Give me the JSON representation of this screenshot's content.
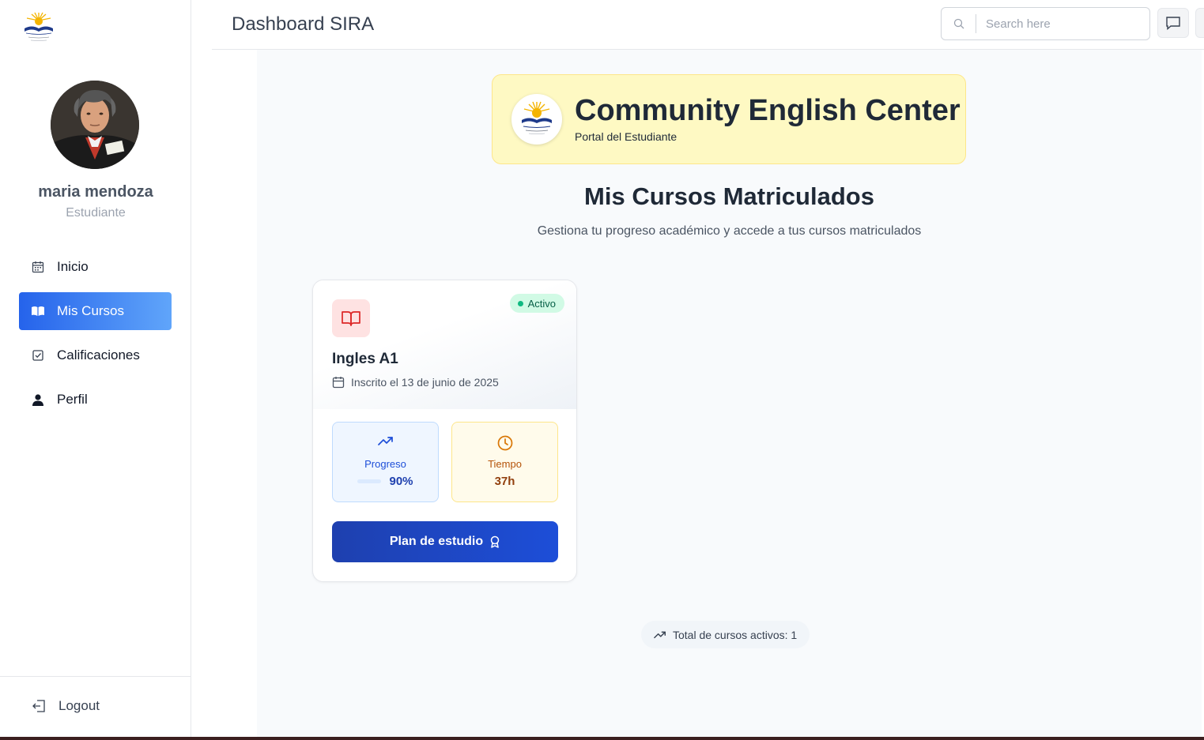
{
  "header": {
    "title": "Dashboard SIRA",
    "search_placeholder": "Search here"
  },
  "sidebar": {
    "user_name": "maria mendoza",
    "user_role": "Estudiante",
    "items": [
      {
        "label": "Inicio",
        "icon": "calendar-icon",
        "active": false
      },
      {
        "label": "Mis Cursos",
        "icon": "book-open-icon",
        "active": true
      },
      {
        "label": "Calificaciones",
        "icon": "check-square-icon",
        "active": false
      },
      {
        "label": "Perfil",
        "icon": "user-icon",
        "active": false
      }
    ],
    "logout_label": "Logout"
  },
  "brand": {
    "name": "Community English Center",
    "subtitle": "Portal del Estudiante"
  },
  "main": {
    "title": "Mis Cursos Matriculados",
    "subtitle": "Gestiona tu progreso académico y accede a tus cursos matriculados",
    "total_label": "Total de cursos activos: 1"
  },
  "course": {
    "name": "Ingles A1",
    "status": "Activo",
    "enrolled": "Inscrito el 13 de junio de 2025",
    "progress_label": "Progreso",
    "progress_value": "90%",
    "progress_fraction": 0.9,
    "time_label": "Tiempo",
    "time_value": "37h",
    "button_label": "Plan de estudio"
  },
  "colors": {
    "accent": "#2563eb",
    "banner": "#fef9c3",
    "status_green": "#10b981",
    "button": "#1e40af"
  }
}
